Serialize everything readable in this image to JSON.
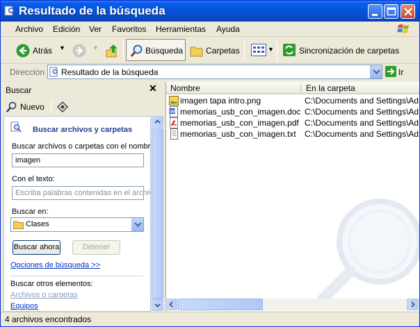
{
  "window": {
    "title": "Resultado de la búsqueda"
  },
  "menu": [
    "Archivo",
    "Edición",
    "Ver",
    "Favoritos",
    "Herramientas",
    "Ayuda"
  ],
  "toolbar": {
    "back_label": "Atrás",
    "search_label": "Búsqueda",
    "folders_label": "Carpetas",
    "sync_label": "Sincronización de carpetas"
  },
  "address": {
    "label": "Dirección",
    "value": "Resultado de la búsqueda",
    "go_label": "Ir"
  },
  "search_pane": {
    "title": "Buscar",
    "new_label": "Nuevo",
    "heading": "Buscar archivos y carpetas",
    "name_label": "Buscar archivos o carpetas con el nombre:",
    "name_value": "imagen",
    "text_label": "Con el texto:",
    "text_placeholder": "Escriba palabras contenidas en el archivo",
    "look_in_label": "Buscar en:",
    "look_in_value": "Clases",
    "search_now": "Buscar ahora",
    "stop": "Detener",
    "options_link": "Opciones de búsqueda  >>",
    "other_label": "Buscar otros elementos:",
    "other_files": "Archivos o carpetas",
    "other_computers": "Equipos"
  },
  "results": {
    "columns": [
      "Nombre",
      "En la carpeta"
    ],
    "rows": [
      {
        "name": "imagen tapa intro.png",
        "folder": "C:\\Documents and Settings\\Ad",
        "icon": "png-image-icon"
      },
      {
        "name": "memorias_usb_con_imagen.doc",
        "folder": "C:\\Documents and Settings\\Ad",
        "icon": "word-doc-icon"
      },
      {
        "name": "memorias_usb_con_imagen.pdf",
        "folder": "C:\\Documents and Settings\\Ad",
        "icon": "pdf-icon"
      },
      {
        "name": "memorias_usb_con_imagen.txt",
        "folder": "C:\\Documents and Settings\\Ad",
        "icon": "text-file-icon"
      }
    ]
  },
  "status": {
    "text": "4 archivos encontrados"
  },
  "colors": {
    "title_blue": "#0453d8",
    "window_bg": "#ece9d8",
    "link_blue": "#0033cc"
  }
}
